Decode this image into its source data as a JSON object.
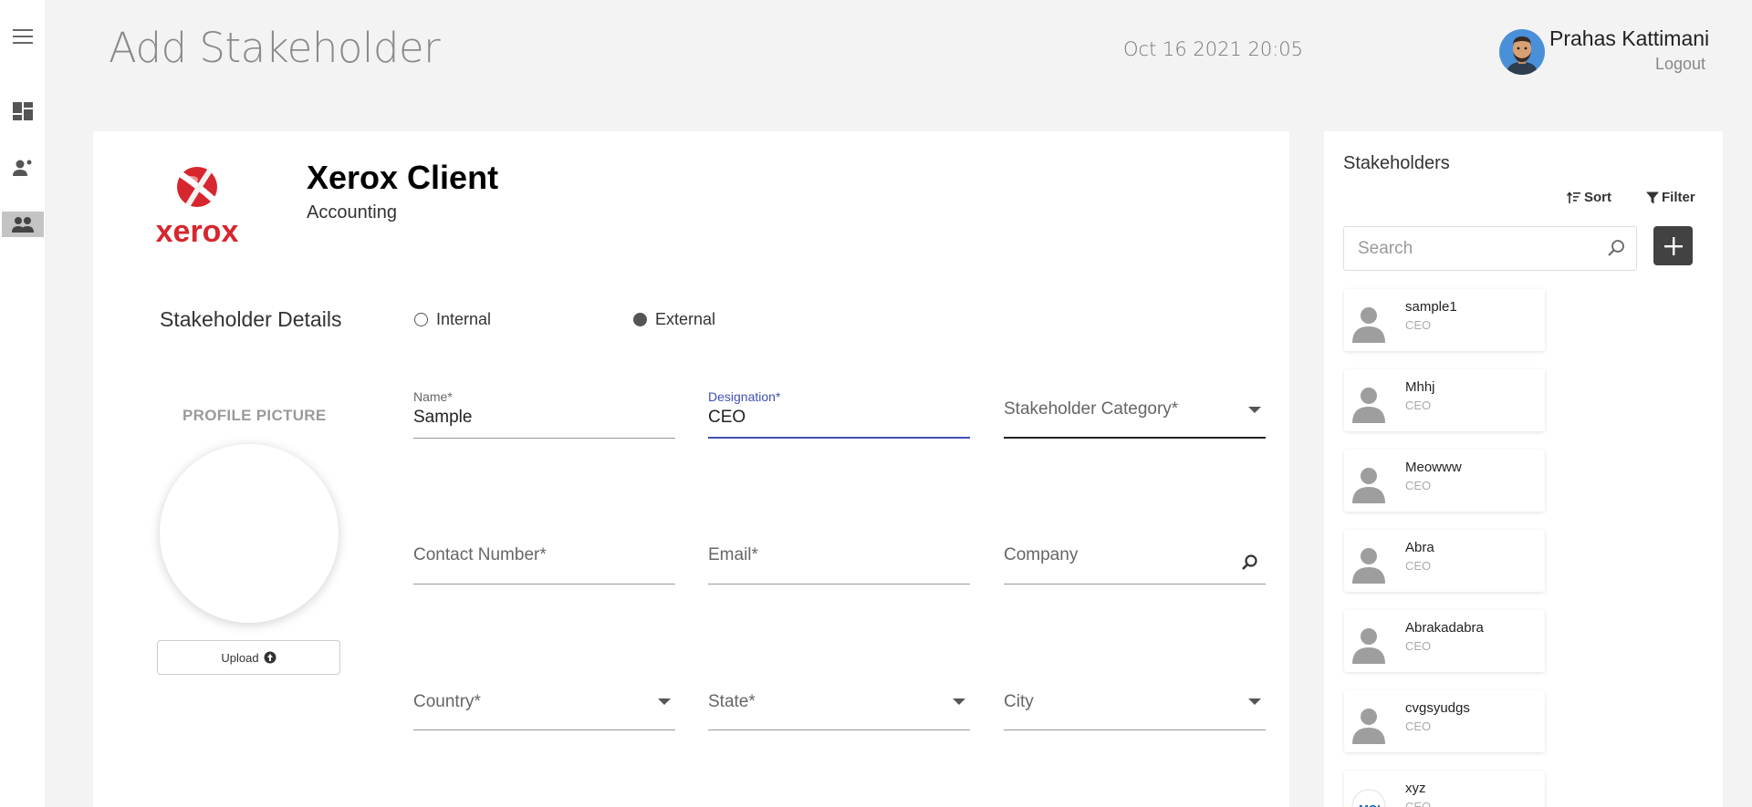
{
  "header": {
    "title": "Add Stakeholder",
    "datetime": "Oct 16 2021  20:05",
    "user_name": "Prahas Kattimani",
    "logout_label": "Logout"
  },
  "sidebar": {
    "items": [
      {
        "icon": "menu-icon",
        "active": false
      },
      {
        "icon": "dashboard-icon",
        "active": false
      },
      {
        "icon": "person-add-icon",
        "active": false
      },
      {
        "icon": "people-icon",
        "active": true
      }
    ]
  },
  "client": {
    "name": "Xerox Client",
    "category": "Accounting",
    "logo_text": "xerox"
  },
  "form": {
    "section_title": "Stakeholder Details",
    "type_options": [
      {
        "label": "Internal",
        "selected": false
      },
      {
        "label": "External",
        "selected": true
      }
    ],
    "profile_picture_label": "PROFILE PICTURE",
    "upload_label": "Upload",
    "fields": {
      "name": {
        "label": "Name*",
        "value": "Sample"
      },
      "designation": {
        "label": "Designation*",
        "value": "CEO"
      },
      "stakeholder_category": {
        "placeholder": "Stakeholder Category*"
      },
      "contact_number": {
        "placeholder": "Contact Number*"
      },
      "email": {
        "placeholder": "Email*"
      },
      "company": {
        "placeholder": "Company"
      },
      "country": {
        "placeholder": "Country*"
      },
      "state": {
        "placeholder": "State*"
      },
      "city": {
        "placeholder": "City"
      }
    }
  },
  "stakeholders_panel": {
    "title": "Stakeholders",
    "sort_label": "Sort",
    "filter_label": "Filter",
    "search_placeholder": "Search",
    "items": [
      {
        "name": "sample1",
        "designation": "CEO"
      },
      {
        "name": "Mhhj",
        "designation": "CEO"
      },
      {
        "name": "Meowww",
        "designation": "CEO"
      },
      {
        "name": "Abra",
        "designation": "CEO"
      },
      {
        "name": "Abrakadabra",
        "designation": "CEO"
      },
      {
        "name": "cvgsyudgs",
        "designation": "CEO"
      },
      {
        "name": "xyz",
        "designation": "CEO"
      }
    ]
  },
  "colors": {
    "accent": "#3f51b5",
    "brand_red": "#d7262e",
    "rail_active": "#c4c4c4",
    "add_button": "#424242"
  }
}
